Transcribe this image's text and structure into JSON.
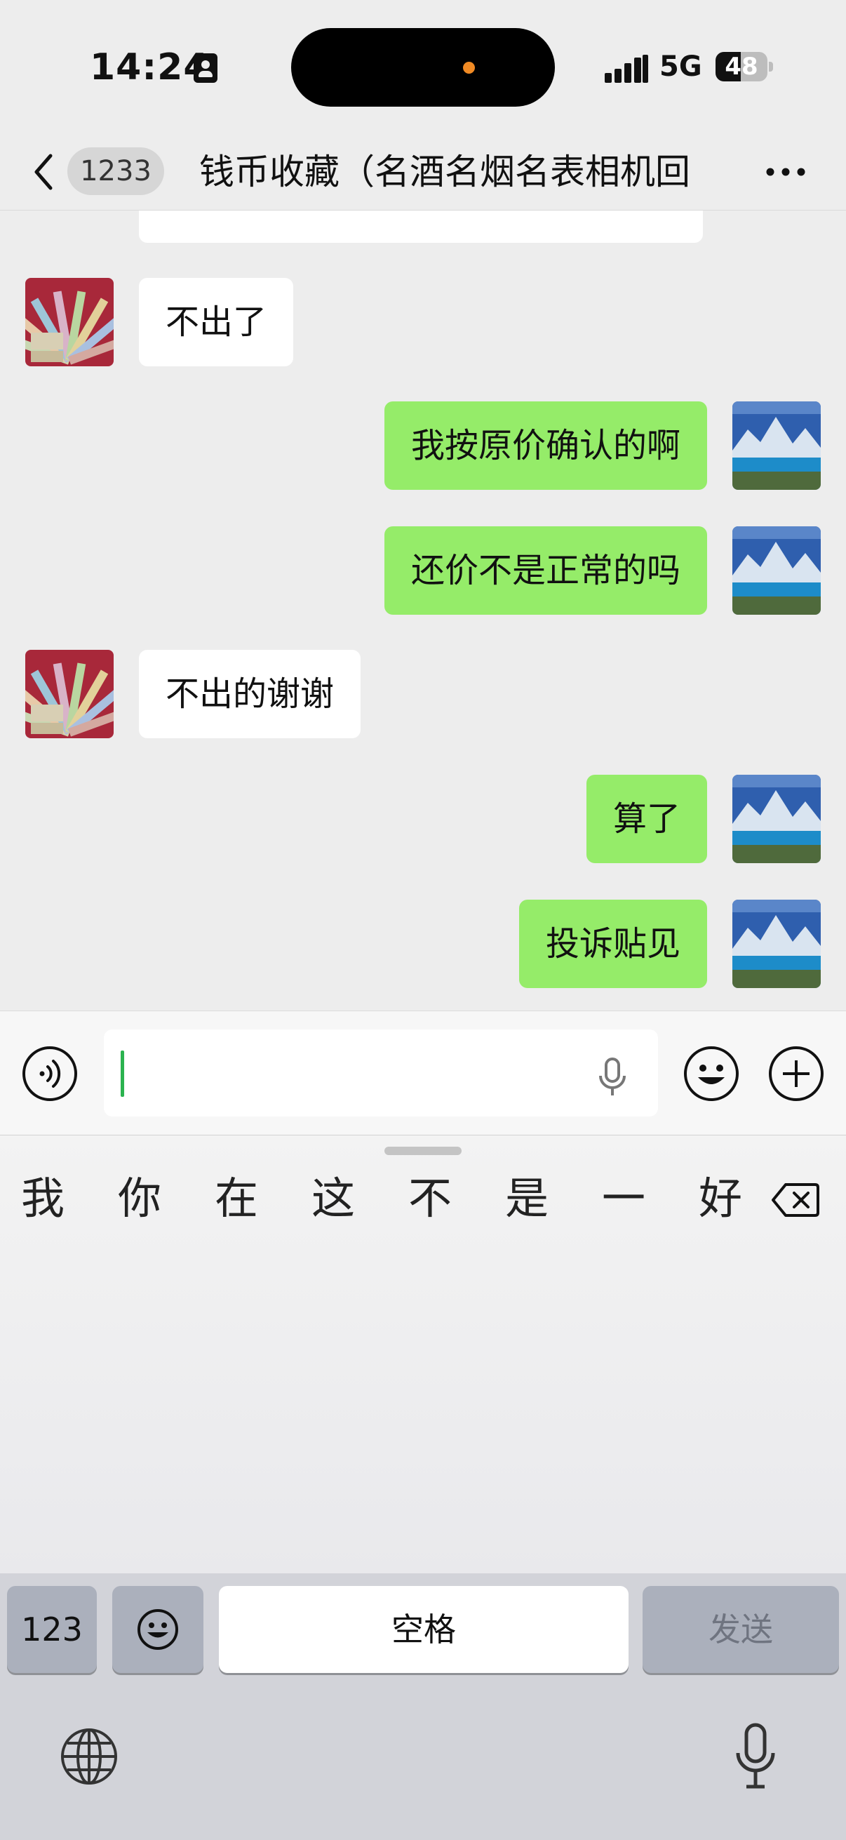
{
  "status_bar": {
    "time": "14:24",
    "network": "5G",
    "battery": "48",
    "battery_level": 0.48
  },
  "nav": {
    "back_badge": "1233",
    "title": "钱币收藏（名酒名烟名表相机回"
  },
  "messages": [
    {
      "side": "in",
      "text": "不出了"
    },
    {
      "side": "out",
      "text": "我按原价确认的啊"
    },
    {
      "side": "out",
      "text": "还价不是正常的吗"
    },
    {
      "side": "in",
      "text": "不出的谢谢"
    },
    {
      "side": "out",
      "text": "算了"
    },
    {
      "side": "out",
      "text": "投诉贴见"
    }
  ],
  "candidates": [
    "我",
    "你",
    "在",
    "这",
    "不",
    "是",
    "一",
    "好"
  ],
  "keyboard": {
    "numbers": "123",
    "space": "空格",
    "send": "发送"
  },
  "colors": {
    "outgoing_bubble": "#95ec69",
    "incoming_bubble": "#ffffff",
    "chat_background": "#ededed",
    "caret": "#2bb34f",
    "island_dot": "#f08a24"
  }
}
